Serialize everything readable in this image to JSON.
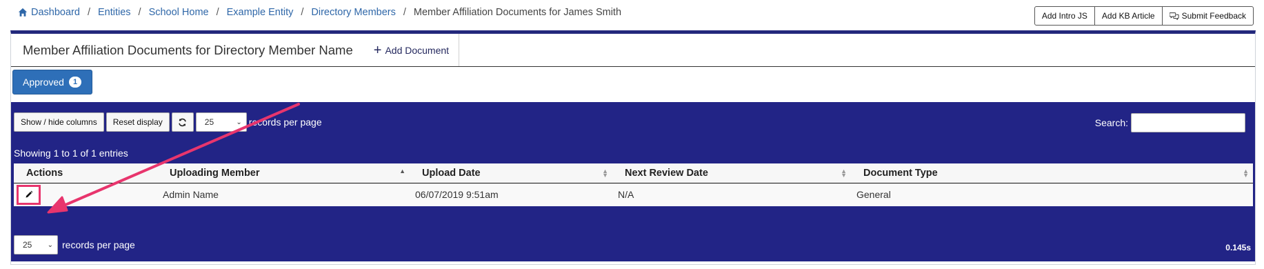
{
  "breadcrumb": {
    "items": [
      "Dashboard",
      "Entities",
      "School Home",
      "Example Entity",
      "Directory Members"
    ],
    "current": "Member Affiliation Documents for James Smith",
    "separator": "/"
  },
  "toolbar": {
    "add_intro_js": "Add Intro JS",
    "add_kb_article": "Add KB Article",
    "submit_feedback": "Submit Feedback"
  },
  "panel": {
    "title": "Member Affiliation Documents for Directory Member Name",
    "add_document": "Add Document",
    "accent_color": "#23287c"
  },
  "tabs": [
    {
      "label": "Approved",
      "count": "1",
      "active": true
    }
  ],
  "datatable": {
    "show_hide_columns": "Show / hide columns",
    "reset_display": "Reset display",
    "refresh_icon": "refresh-icon",
    "page_length": "25",
    "records_per_page": "records per page",
    "search_label": "Search:",
    "search_value": "",
    "info": "Showing 1 to 1 of 1 entries",
    "background_color": "#222486",
    "columns": [
      "Actions",
      "Uploading Member",
      "Upload Date",
      "Next Review Date",
      "Document Type"
    ],
    "rows": [
      {
        "action_icon": "pencil-icon",
        "uploading_member": "Admin Name",
        "upload_date": "06/07/2019 9:51am",
        "next_review_date": "N/A",
        "document_type": "General"
      }
    ],
    "footer_page_length": "25",
    "footer_records_per_page": "records per page",
    "timing": "0.145s"
  },
  "annotation": {
    "color": "#e8356d"
  }
}
